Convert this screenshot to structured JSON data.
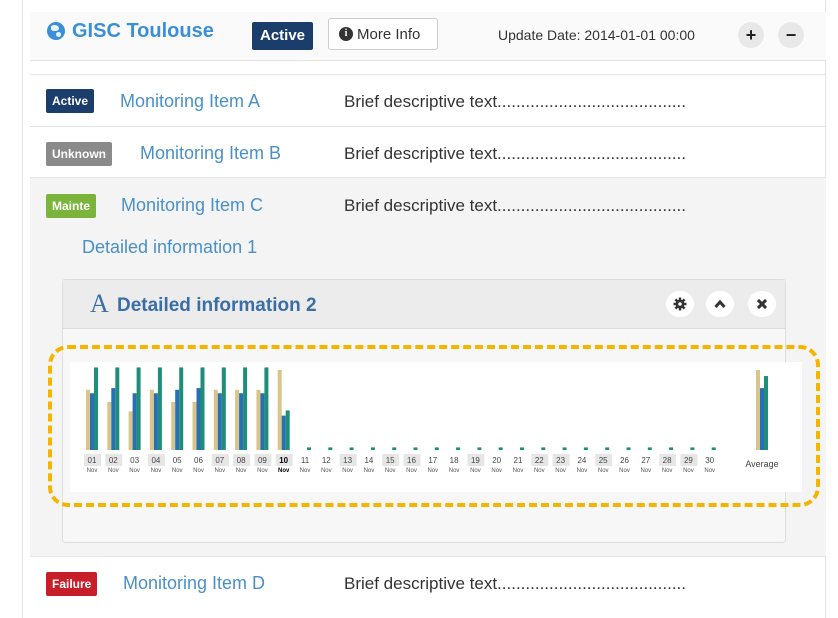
{
  "header": {
    "title": "GISC Toulouse",
    "status": "Active",
    "more_info": "More Info",
    "update_date": "Update Date: 2014-01-01 00:00",
    "plus": "+",
    "minus": "−"
  },
  "items": [
    {
      "badge": "Active",
      "badge_color": "#1a3d6c",
      "name": "Monitoring Item A",
      "desc": "Brief descriptive text........................................"
    },
    {
      "badge": "Unknown",
      "badge_color": "#8a8a8a",
      "name": "Monitoring Item B",
      "desc": "Brief descriptive text........................................"
    },
    {
      "badge": "Mainte",
      "badge_color": "#7ab43a",
      "name": "Monitoring Item C",
      "desc": "Brief descriptive text........................................"
    },
    {
      "badge": "Failure",
      "badge_color": "#c81e2a",
      "name": "Monitoring Item D",
      "desc": "Brief descriptive text........................................"
    }
  ],
  "detail1": "Detailed information 1",
  "widget": {
    "icon_letter": "A",
    "title": "Detailed information 2",
    "icons": [
      "gear-icon",
      "chevron-up-icon",
      "close-icon"
    ]
  },
  "chart_data": {
    "type": "bar",
    "categories": [
      "01",
      "02",
      "03",
      "04",
      "05",
      "06",
      "07",
      "08",
      "09",
      "10",
      "11",
      "12",
      "13",
      "14",
      "15",
      "16",
      "17",
      "18",
      "19",
      "20",
      "21",
      "22",
      "23",
      "24",
      "25",
      "26",
      "27",
      "28",
      "29",
      "30"
    ],
    "sublabel": "Nov",
    "highlight_category": "10",
    "average_label": "Average",
    "series": [
      {
        "color": "#d9c48a",
        "values": [
          0.7,
          0.56,
          0.45,
          0.7,
          0.56,
          0.56,
          0.7,
          0.7,
          0.7,
          0.93,
          0,
          0,
          0,
          0,
          0,
          0,
          0,
          0,
          0,
          0,
          0,
          0,
          0,
          0,
          0,
          0,
          0,
          0,
          0,
          0
        ],
        "average": 0.93
      },
      {
        "color": "#2a6fb5",
        "values": [
          0.66,
          0.72,
          0.66,
          0.66,
          0.7,
          0.72,
          0.66,
          0.66,
          0.66,
          0.4,
          0,
          0,
          0,
          0,
          0,
          0,
          0,
          0,
          0,
          0,
          0,
          0,
          0,
          0,
          0,
          0,
          0,
          0,
          0,
          0
        ],
        "average": 0.72
      },
      {
        "color": "#1e8e78",
        "values": [
          0.96,
          0.96,
          0.96,
          0.96,
          0.96,
          0.96,
          0.96,
          0.96,
          0.96,
          0.46,
          0.03,
          0.03,
          0.03,
          0.03,
          0.03,
          0.03,
          0.03,
          0.03,
          0.03,
          0.03,
          0.03,
          0.03,
          0.03,
          0.03,
          0.03,
          0.03,
          0.03,
          0.03,
          0.03,
          0.03
        ],
        "average": 0.86
      }
    ],
    "ylim": [
      0,
      1
    ]
  }
}
